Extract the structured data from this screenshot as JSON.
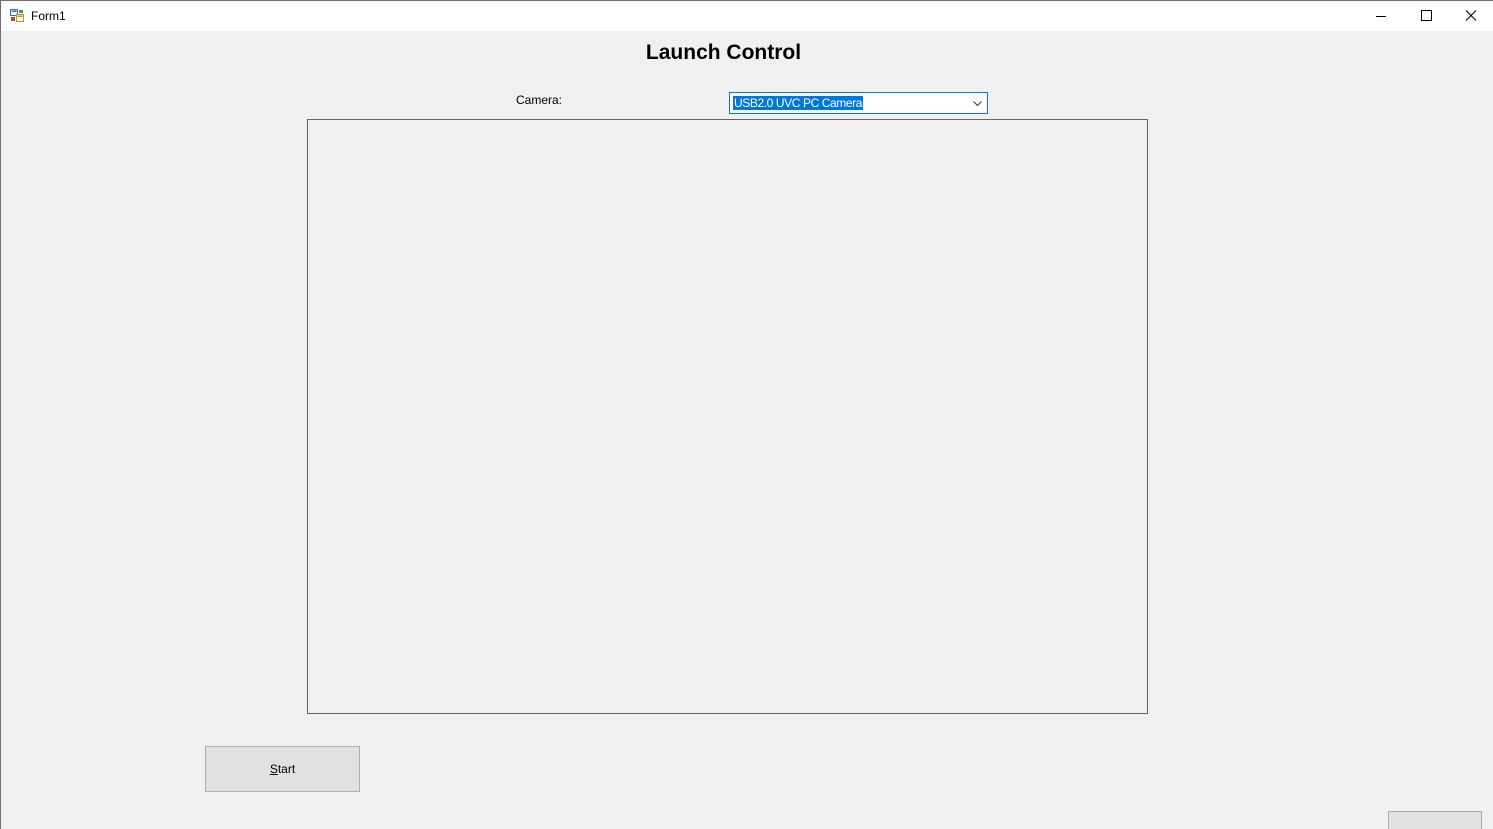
{
  "window": {
    "title": "Form1",
    "controls": {
      "minimize": "minimize-icon",
      "maximize": "maximize-icon",
      "close": "close-icon"
    }
  },
  "main": {
    "heading": "Launch Control",
    "camera_label": "Camera:",
    "camera_select": {
      "value": "USB2.0 UVC PC Camera"
    },
    "start_button": {
      "mnemonic": "S",
      "rest": "tart"
    }
  },
  "colors": {
    "background": "#f0f0f0",
    "titlebar": "#ffffff",
    "selection": "#0078d7",
    "button_face": "#e1e1e1",
    "button_border": "#adadad"
  }
}
